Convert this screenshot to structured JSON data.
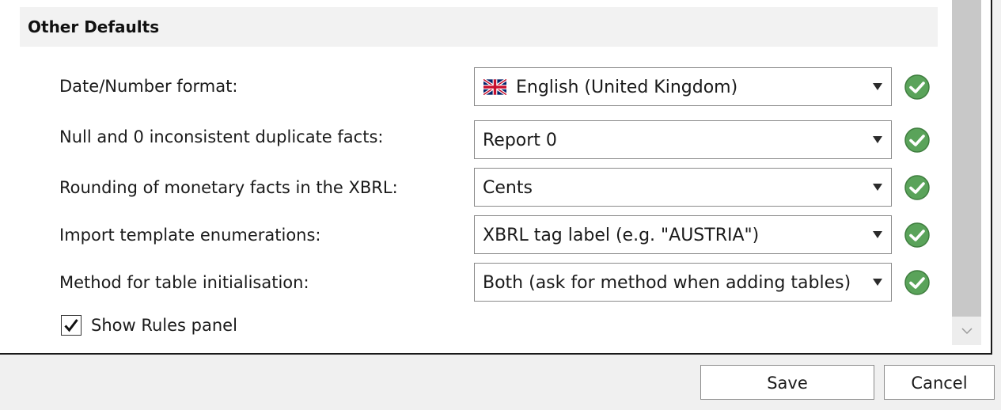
{
  "section": {
    "title": "Other Defaults"
  },
  "settings": [
    {
      "label": "Date/Number format:",
      "value": "English (United Kingdom)",
      "icon": "uk-flag-icon",
      "status": "ok-check-icon"
    },
    {
      "label": "Null and 0 inconsistent duplicate facts:",
      "value": "Report 0",
      "status": "ok-check-icon"
    },
    {
      "label": "Rounding of monetary facts in the XBRL:",
      "value": "Cents",
      "status": "ok-check-icon"
    },
    {
      "label": "Import template enumerations:",
      "value": "XBRL tag label (e.g. \"AUSTRIA\")",
      "status": "ok-check-icon"
    },
    {
      "label": "Method for table initialisation:",
      "value": "Both (ask for method when adding tables)",
      "status": "ok-check-icon"
    }
  ],
  "show_rules": {
    "label": "Show Rules panel",
    "checked": true
  },
  "buttons": {
    "save": "Save",
    "cancel": "Cancel"
  },
  "colors": {
    "ok_green": "#5aa35a",
    "header_bg": "#f2f2f2",
    "scroll_thumb": "#c8c8c8"
  }
}
